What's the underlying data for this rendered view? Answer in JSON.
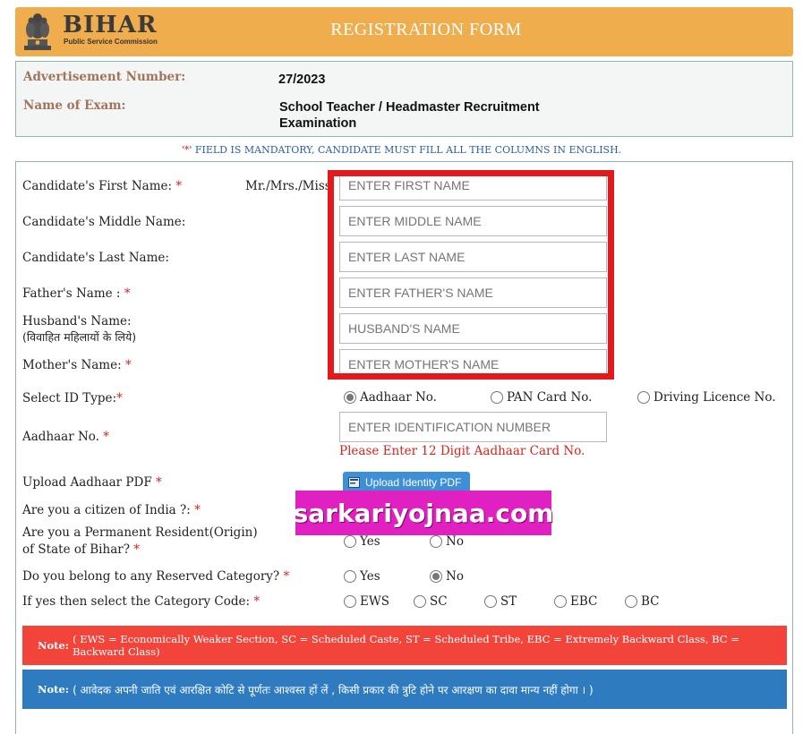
{
  "header": {
    "logo_text": "BIHAR",
    "logo_subtext": "Public Service Commission",
    "title": "REGISTRATION FORM"
  },
  "advert": {
    "advertisement_label": "Advertisement Number:",
    "advertisement_value": "27/2023",
    "exam_label": "Name of Exam:",
    "exam_value_line1": "School Teacher / Headmaster Recruitment",
    "exam_value_line2": "Examination"
  },
  "mandatory_note": {
    "prefix": "'",
    "star": "*",
    "suffix": "' FIELD IS MANDATORY, CANDIDATE MUST FILL ALL THE COLUMNS IN ENGLISH."
  },
  "form": {
    "first_name_label": "Candidate's First Name:",
    "salutation": "Mr./Mrs./Miss",
    "first_name_placeholder": "ENTER FIRST NAME",
    "middle_name_label": "Candidate's Middle Name:",
    "middle_name_placeholder": "ENTER MIDDLE NAME",
    "last_name_label": "Candidate's Last Name:",
    "last_name_placeholder": "ENTER LAST NAME",
    "father_label": "Father's Name :",
    "father_placeholder": "ENTER FATHER'S NAME",
    "husband_label": "Husband's Name:",
    "husband_sublabel": "(विवाहित महिलायों के लिये)",
    "husband_placeholder": "HUSBAND'S NAME",
    "mother_label": "Mother's Name:",
    "mother_placeholder": "ENTER MOTHER'S NAME",
    "id_type_label": "Select ID Type:",
    "id_options": [
      "Aadhaar No.",
      "PAN Card No.",
      "Driving Licence No."
    ],
    "id_selected": "Aadhaar No.",
    "aadhaar_label": "Aadhaar No.",
    "aadhaar_placeholder": "ENTER IDENTIFICATION NUMBER",
    "aadhaar_error": "Please Enter 12 Digit Aadhaar Card No.",
    "upload_label": "Upload Aadhaar PDF",
    "upload_button": "Upload Identity PDF",
    "citizen_label": "Are you a citizen of India ?:",
    "resident_label_line1": "Are you a Permanent Resident(Origin)",
    "resident_label_line2": "of State of Bihar?",
    "resident_options": [
      "Yes",
      "No"
    ],
    "reserved_label": "Do you belong to any Reserved Category?",
    "reserved_options": [
      "Yes",
      "No"
    ],
    "reserved_selected": "No",
    "category_label": "If yes then select the Category Code:",
    "category_options": [
      "EWS",
      "SC",
      "ST",
      "EBC",
      "BC"
    ],
    "required_star": "*"
  },
  "watermark": "sarkariyojnaa.com",
  "notes": {
    "note_prefix": "Note:",
    "note1_text": "( EWS = Economically Weaker Section, SC = Scheduled Caste, ST = Scheduled Tribe, EBC = Extremely Backward Class, BC = Backward Class)",
    "note2_text": "( आवेदक अपनी जाति एवं आरक्षित कोटि से पूर्णतः आश्वस्त हों लें , किसी प्रकार की त्रुटि होने पर आरक्षण का दावा मान्य नहीं होगा । )"
  },
  "colors": {
    "header_bg": "#f0ad4e",
    "highlight": "#e4191b",
    "watermark_bg": "#e020c0",
    "note1_bg": "#f2443b",
    "note2_bg": "#2e7bbf",
    "link_blue": "#2a5db0"
  }
}
